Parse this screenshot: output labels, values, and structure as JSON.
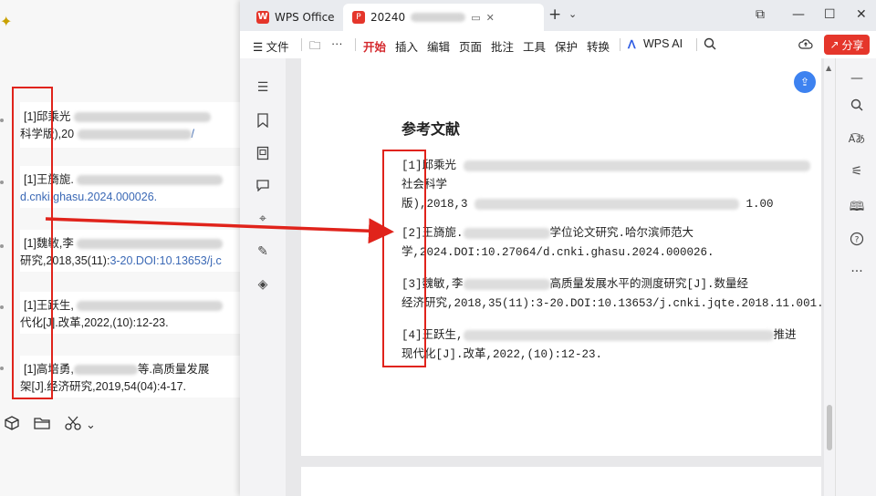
{
  "left_panel": {
    "refs": [
      {
        "line1": "[1]邱乘光",
        "line2": "科学版),20",
        "line2_tail": "/"
      },
      {
        "line1": "[1]王旖旎.",
        "line2": "d.cnki.ghasu.2024.000026."
      },
      {
        "line1": "[1]魏敏,李",
        "line2": "研究,2018,35(11):",
        "line2_link": "3-20.DOI:10.13653/j.c"
      },
      {
        "line1": "[1]王跃生,",
        "line2": "代化[J].改革,2022,(10):12-23."
      },
      {
        "line1": "[1]高培勇,",
        "line1_tail": "等.高质量发展",
        "line2": "架[J].经济研究,2019,54(04):4-17."
      }
    ],
    "bottom_icons": [
      "cube-icon",
      "folder-icon",
      "scissors-icon"
    ],
    "bottom_caret": "⌄"
  },
  "wps": {
    "tabs": {
      "home_label": "WPS Office",
      "doc_label": "20240",
      "close": "✕",
      "new_tab": "+",
      "dropdown": "⌄"
    },
    "window_controls": {
      "restore": "⧉",
      "minimize": "—",
      "maximize": "☐",
      "close": "✕"
    },
    "toolbar": {
      "file": "☰ 文件",
      "folder": "🗀",
      "more": "···",
      "items": [
        "开始",
        "插入",
        "编辑",
        "页面",
        "批注",
        "工具",
        "保护",
        "转换"
      ],
      "ai": "WPS AI",
      "share": "分享"
    },
    "document": {
      "title": "参考文献",
      "entries": [
        {
          "l1": "[1]邱乘光",
          "l2": "社会科学",
          "l3": "版),2018,3",
          "l3_tail": "1.00"
        },
        {
          "l1": "[2]王旖旎.",
          "l1_tail": "学位论文研究.哈尔滨师范大",
          "l2": "学,2024.DOI:10.27064/d.cnki.ghasu.2024.000026."
        },
        {
          "l1": "[3]魏敏,李",
          "l1_tail": "高质量发展水平的测度研究[J].数量经",
          "l2": "经济研究,2018,35(11):3-20.DOI:10.13653/j.cnki.jqte.2018.11.001."
        },
        {
          "l1": "[4]王跃生,",
          "l1_tail": "推进",
          "l2": "现代化[J].改革,2022,(10):12-23."
        }
      ]
    }
  },
  "colors": {
    "accent": "#d4282d",
    "annotation": "#e0231b",
    "link": "#3a68b5"
  }
}
